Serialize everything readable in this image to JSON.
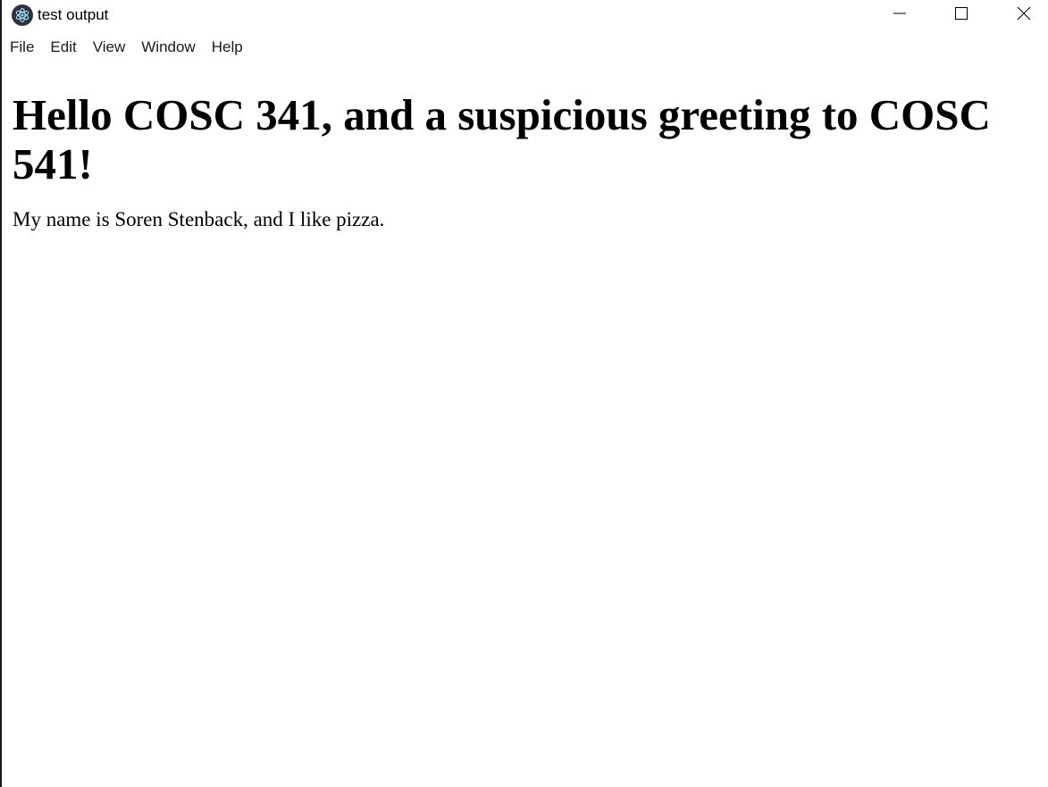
{
  "window": {
    "title": "test output",
    "icon": "electron-app-icon",
    "controls": [
      "minimize-icon",
      "maximize-icon",
      "close-icon"
    ]
  },
  "menu": {
    "items": [
      "File",
      "Edit",
      "View",
      "Window",
      "Help"
    ]
  },
  "page": {
    "heading": "Hello COSC 341, and a suspicious greeting to COSC 541!",
    "paragraph": "My name is Soren Stenback, and I like pizza."
  },
  "colors": {
    "background": "#ffffff",
    "text": "#000000",
    "app_icon_bg": "#2f3242"
  }
}
